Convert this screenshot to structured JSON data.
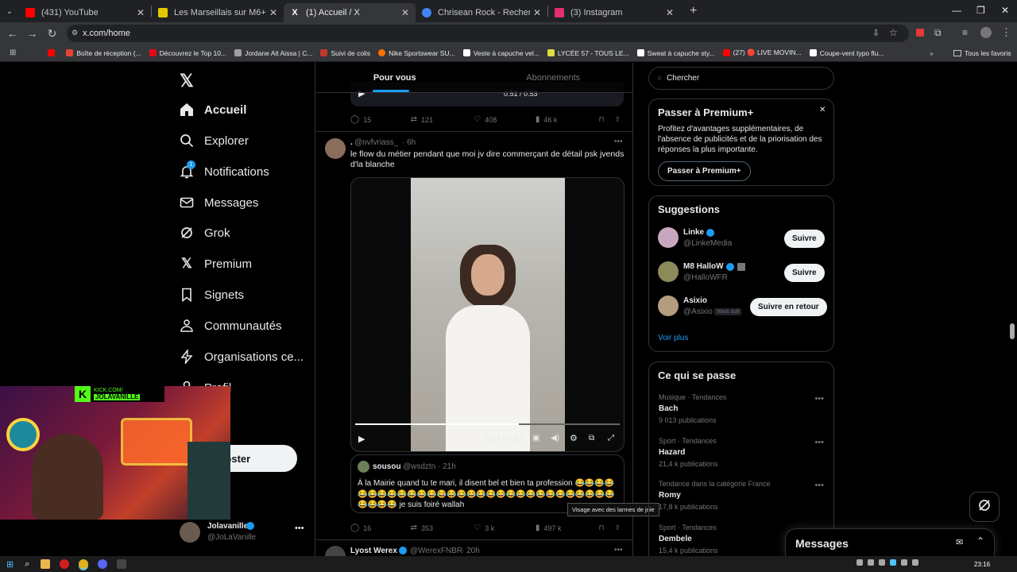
{
  "browser": {
    "tabs": [
      {
        "title": "(431) YouTube",
        "color": "#ff0000",
        "active": false
      },
      {
        "title": "Les Marseillais sur M6+ : voir le",
        "color": "#e5c900",
        "active": false
      },
      {
        "title": "(1) Accueil / X",
        "color": "#ffffff",
        "active": true
      },
      {
        "title": "Chrisean Rock - Recherche Goo",
        "color": "#4285f4",
        "active": false
      },
      {
        "title": "(3) Instagram",
        "color": "#e1306c",
        "active": false
      }
    ],
    "url": "x.com/home",
    "bookmarks": [
      {
        "label": "Boîte de réception (...",
        "color": "#ea4335"
      },
      {
        "label": "Découvrez le Top 10...",
        "color": "#e50914"
      },
      {
        "label": "Jordane Ait Aissa | C...",
        "color": "#a0a0a0"
      },
      {
        "label": "Suivi de colis",
        "color": "#c0392b"
      },
      {
        "label": "Nike Sportswear SU...",
        "color": "#ff6f00"
      },
      {
        "label": "Veste à capuche vel...",
        "color": "#ffffff"
      },
      {
        "label": "LYCÉE 57 - TOUS LE...",
        "color": "#dddd44"
      },
      {
        "label": "Sweat à capuche sty...",
        "color": "#ffffff"
      },
      {
        "label": "(27) 🔴 LIVE MOVIN...",
        "color": "#ff0000"
      },
      {
        "label": "Coupe-vent typo flu...",
        "color": "#ffffff"
      }
    ],
    "all_favorites": "Tous les favoris"
  },
  "nav": {
    "items": [
      {
        "label": "Accueil",
        "icon": "home-icon",
        "active": true
      },
      {
        "label": "Explorer",
        "icon": "search-icon"
      },
      {
        "label": "Notifications",
        "icon": "bell-icon",
        "badge": "1"
      },
      {
        "label": "Messages",
        "icon": "mail-icon"
      },
      {
        "label": "Grok",
        "icon": "grok-icon"
      },
      {
        "label": "Premium",
        "icon": "x-icon"
      },
      {
        "label": "Signets",
        "icon": "bookmark-icon"
      },
      {
        "label": "Communautés",
        "icon": "people-icon"
      },
      {
        "label": "Organisations ce...",
        "icon": "lightning-icon"
      },
      {
        "label": "Profil",
        "icon": "person-icon"
      }
    ],
    "post_button": "Poster",
    "account": {
      "name": "Jolavanille",
      "handle": "@JoLaVanille"
    }
  },
  "feed": {
    "tabs": [
      "Pour vous",
      "Abonnements"
    ],
    "prev_post": {
      "time": "0:51 / 0:53",
      "replies": "15",
      "reposts": "121",
      "likes": "408",
      "views": "46 k"
    },
    "post": {
      "author": ".",
      "handle": "@nvfvriass_",
      "time": "· 6h",
      "text": "le flow du métier pendant que moi jv dire commerçant de détail psk jvends d'la blanche",
      "video_time": "0:23 / 0:37",
      "video_progress": 0.62,
      "quote": {
        "author": "sousou",
        "handle": "@wsdztn",
        "time": "· 21h",
        "text": "À la Mairie quand tu te mari, il disent bel et bien ta profession 😂😂😂😂😂😂😂😂😂😂😂😂😂😂😂😂😂😂😂😂😂😂😂😂😂😂😂😂😂😂😂😂😂😂 je suis foiré wallah"
      },
      "tooltip": "Visage avec des larmes de joie",
      "replies": "16",
      "reposts": "353",
      "likes": "3 k",
      "views": "497 k"
    },
    "next_post": {
      "author": "Lyost Werex",
      "handle": "@WerexFNBR",
      "time": "· 20h"
    }
  },
  "right": {
    "search_placeholder": "Chercher",
    "premium": {
      "title": "Passer à Premium+",
      "text": "Profitez d'avantages supplémentaires, de l'absence de publicités et de la priorisation des réponses la plus importante.",
      "button": "Passer à Premium+"
    },
    "suggestions": {
      "title": "Suggestions",
      "users": [
        {
          "name": "Linke",
          "handle": "@LinkeMedia",
          "button": "Suivre"
        },
        {
          "name": "M8 HalloW",
          "handle": "@HalloWFR",
          "button": "Suivre"
        },
        {
          "name": "Asixio",
          "handle": "@Asixio",
          "badge": "Vous suit",
          "button": "Suivre en retour"
        }
      ],
      "more": "Voir plus"
    },
    "trends": {
      "title": "Ce qui se passe",
      "items": [
        {
          "cat": "Musique · Tendances",
          "name": "Bach",
          "count": "9 013 publications"
        },
        {
          "cat": "Sport · Tendances",
          "name": "Hazard",
          "count": "21,4 k publications"
        },
        {
          "cat": "Tendance dans la catégorie France",
          "name": "Romy",
          "count": "17,8 k publications"
        },
        {
          "cat": "Sport · Tendances",
          "name": "Dembele",
          "count": "15,4 k publications"
        }
      ]
    },
    "messages_drawer": "Messages"
  },
  "webcam": {
    "overlay": "KICK.COM/",
    "channel": "JOLAVANILLE"
  },
  "taskbar": {
    "time": "23:16"
  }
}
